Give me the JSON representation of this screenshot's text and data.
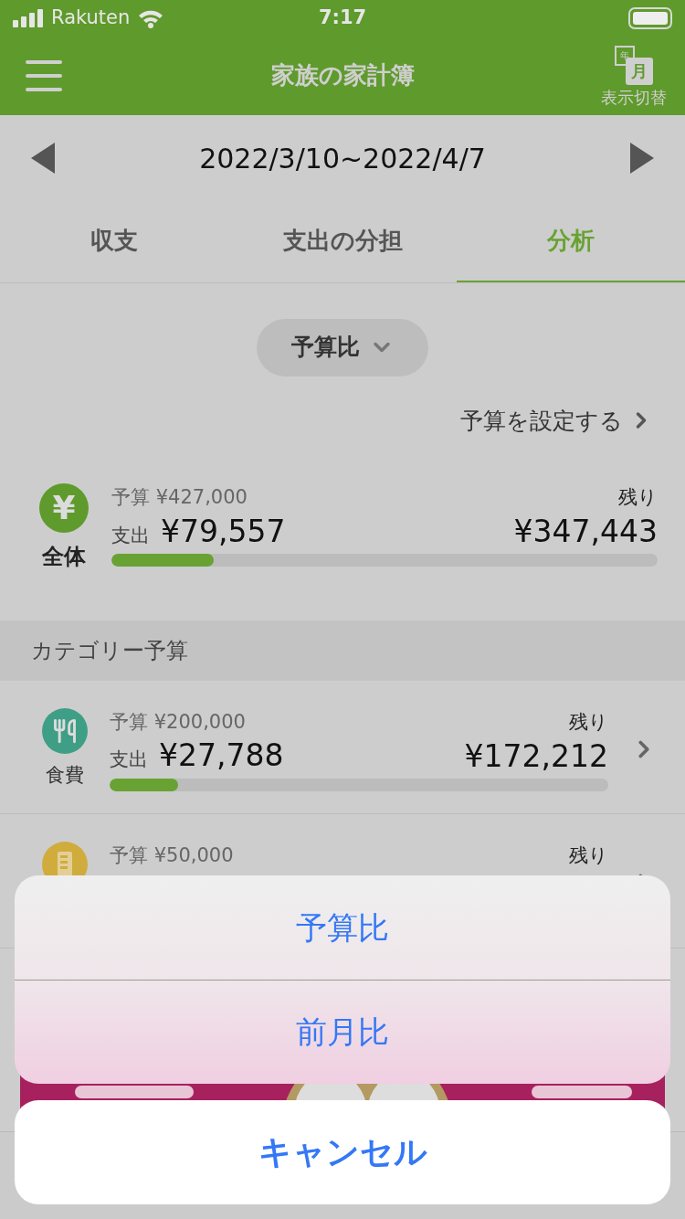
{
  "status_bar": {
    "carrier": "Rakuten",
    "time": "7:17"
  },
  "header": {
    "title": "家族の家計簿",
    "view_switch": {
      "label": "表示切替",
      "year_mark": "年",
      "month_mark": "月"
    }
  },
  "period": "2022/3/10~2022/4/7",
  "tabs": [
    {
      "label": "収支",
      "selected": false
    },
    {
      "label": "支出の分担",
      "selected": false
    },
    {
      "label": "分析",
      "selected": true
    }
  ],
  "compare_dropdown": "予算比",
  "budget_link": "予算を設定する",
  "overall": {
    "icon_glyph": "¥",
    "label": "全体",
    "budget_label": "予算",
    "budget": "¥427,000",
    "spent_label": "支出",
    "spent": "¥79,557",
    "remaining_label": "残り",
    "remaining": "¥347,443",
    "level": 0.187
  },
  "section_title": "カテゴリー予算",
  "categories": [
    {
      "kind": "food",
      "color": "#3f9f86",
      "name": "食費",
      "budget_label": "予算",
      "budget": "¥200,000",
      "spent_label": "支出",
      "spent": "¥27,788",
      "remaining_label": "残り",
      "remaining": "¥172,212",
      "level": 0.138
    },
    {
      "kind": "daily",
      "color": "#d0ac3c",
      "budget_label": "予算",
      "budget": "¥50,000",
      "remaining_label": "残り"
    }
  ],
  "action_sheet": {
    "options": [
      "予算比",
      "前月比"
    ],
    "cancel": "キャンセル"
  }
}
